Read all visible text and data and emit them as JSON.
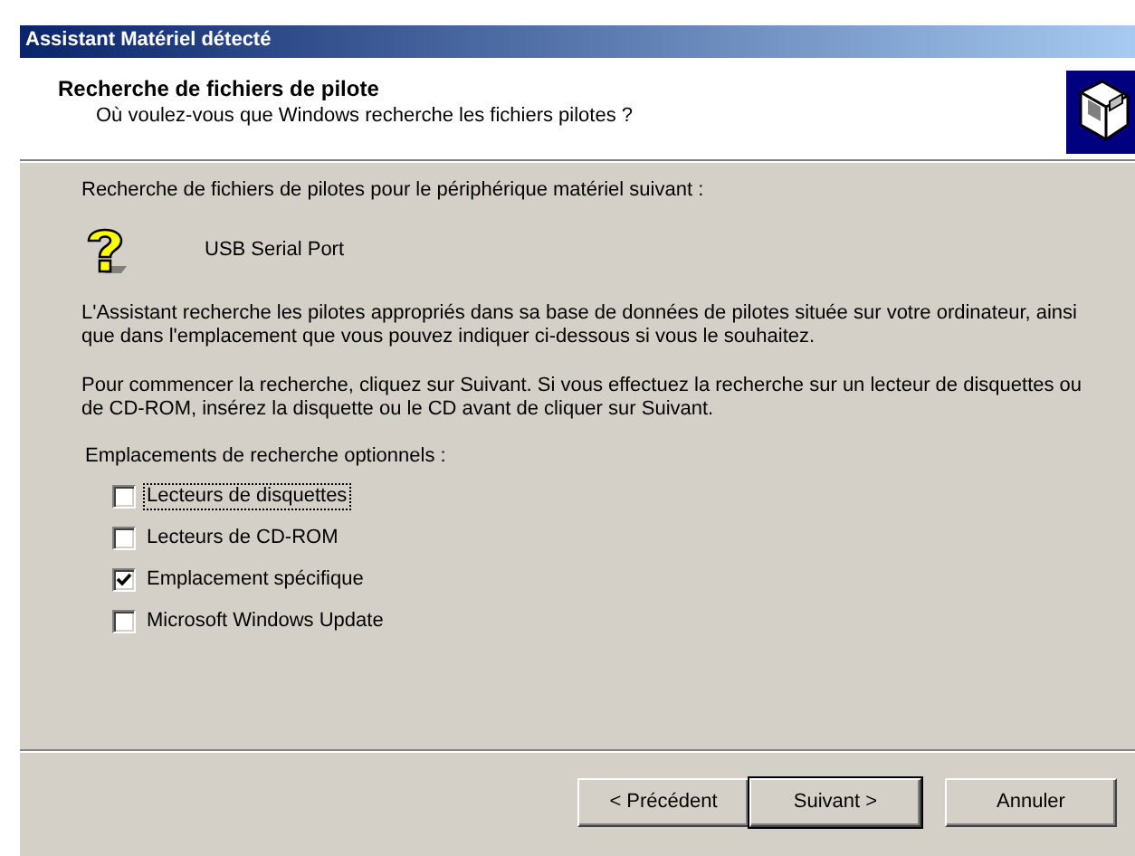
{
  "window": {
    "title": "Assistant Matériel détecté"
  },
  "header": {
    "title": "Recherche de fichiers de pilote",
    "subtitle": "Où voulez-vous que Windows recherche les fichiers pilotes ?"
  },
  "intro": "Recherche de fichiers de pilotes pour le périphérique matériel suivant :",
  "device": {
    "name": "USB Serial Port"
  },
  "paragraphs": [
    "L'Assistant recherche les pilotes appropriés dans sa base de données de pilotes située sur votre ordinateur, ainsi que dans l'emplacement que vous pouvez indiquer ci-dessous si vous le souhaitez.",
    "Pour commencer la recherche, cliquez sur Suivant. Si vous effectuez la recherche sur un lecteur de disquettes ou de CD-ROM, insérez la disquette ou le CD avant de cliquer sur Suivant."
  ],
  "options_label": "Emplacements de recherche optionnels :",
  "options": [
    {
      "label": "Lecteurs de disquettes",
      "checked": false,
      "focused": true
    },
    {
      "label": "Lecteurs de CD-ROM",
      "checked": false,
      "focused": false
    },
    {
      "label": "Emplacement spécifique",
      "checked": true,
      "focused": false
    },
    {
      "label": "Microsoft Windows Update",
      "checked": false,
      "focused": false
    }
  ],
  "buttons": [
    {
      "label": "< Précédent",
      "default": false
    },
    {
      "label": "Suivant >",
      "default": true
    },
    {
      "label": "Annuler",
      "default": false
    }
  ]
}
